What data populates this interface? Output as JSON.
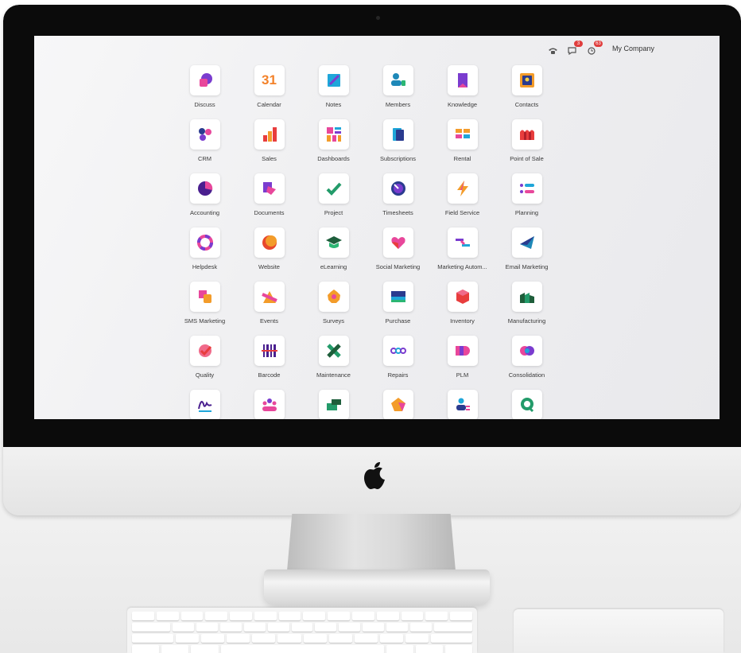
{
  "topbar": {
    "messages_count": "3",
    "activity_count": "63",
    "company_name": "My Company"
  },
  "apps": [
    {
      "label": "Discuss",
      "icon": "discuss-icon"
    },
    {
      "label": "Calendar",
      "icon": "calendar-icon",
      "icon_text": "31"
    },
    {
      "label": "Notes",
      "icon": "notes-icon"
    },
    {
      "label": "Members",
      "icon": "members-icon"
    },
    {
      "label": "Knowledge",
      "icon": "knowledge-icon"
    },
    {
      "label": "Contacts",
      "icon": "contacts-icon"
    },
    {
      "label": "CRM",
      "icon": "crm-icon"
    },
    {
      "label": "Sales",
      "icon": "sales-icon"
    },
    {
      "label": "Dashboards",
      "icon": "dashboards-icon"
    },
    {
      "label": "Subscriptions",
      "icon": "subscriptions-icon"
    },
    {
      "label": "Rental",
      "icon": "rental-icon"
    },
    {
      "label": "Point of Sale",
      "icon": "point-of-sale-icon"
    },
    {
      "label": "Accounting",
      "icon": "accounting-icon"
    },
    {
      "label": "Documents",
      "icon": "documents-icon"
    },
    {
      "label": "Project",
      "icon": "project-icon"
    },
    {
      "label": "Timesheets",
      "icon": "timesheets-icon"
    },
    {
      "label": "Field Service",
      "icon": "field-service-icon"
    },
    {
      "label": "Planning",
      "icon": "planning-icon"
    },
    {
      "label": "Helpdesk",
      "icon": "helpdesk-icon"
    },
    {
      "label": "Website",
      "icon": "website-icon"
    },
    {
      "label": "eLearning",
      "icon": "elearning-icon"
    },
    {
      "label": "Social Marketing",
      "icon": "social-marketing-icon"
    },
    {
      "label": "Marketing Autom...",
      "icon": "marketing-automation-icon"
    },
    {
      "label": "Email Marketing",
      "icon": "email-marketing-icon"
    },
    {
      "label": "SMS Marketing",
      "icon": "sms-marketing-icon"
    },
    {
      "label": "Events",
      "icon": "events-icon"
    },
    {
      "label": "Surveys",
      "icon": "surveys-icon"
    },
    {
      "label": "Purchase",
      "icon": "purchase-icon"
    },
    {
      "label": "Inventory",
      "icon": "inventory-icon"
    },
    {
      "label": "Manufacturing",
      "icon": "manufacturing-icon"
    },
    {
      "label": "Quality",
      "icon": "quality-icon"
    },
    {
      "label": "Barcode",
      "icon": "barcode-icon"
    },
    {
      "label": "Maintenance",
      "icon": "maintenance-icon"
    },
    {
      "label": "Repairs",
      "icon": "repairs-icon"
    },
    {
      "label": "PLM",
      "icon": "plm-icon"
    },
    {
      "label": "Consolidation",
      "icon": "consolidation-icon"
    },
    {
      "label": "",
      "icon": "sign-icon"
    },
    {
      "label": "",
      "icon": "employees-icon"
    },
    {
      "label": "",
      "icon": "payroll-icon"
    },
    {
      "label": "",
      "icon": "appraisals-icon"
    },
    {
      "label": "",
      "icon": "recruitment-icon"
    },
    {
      "label": "",
      "icon": "live-chat-icon"
    }
  ]
}
